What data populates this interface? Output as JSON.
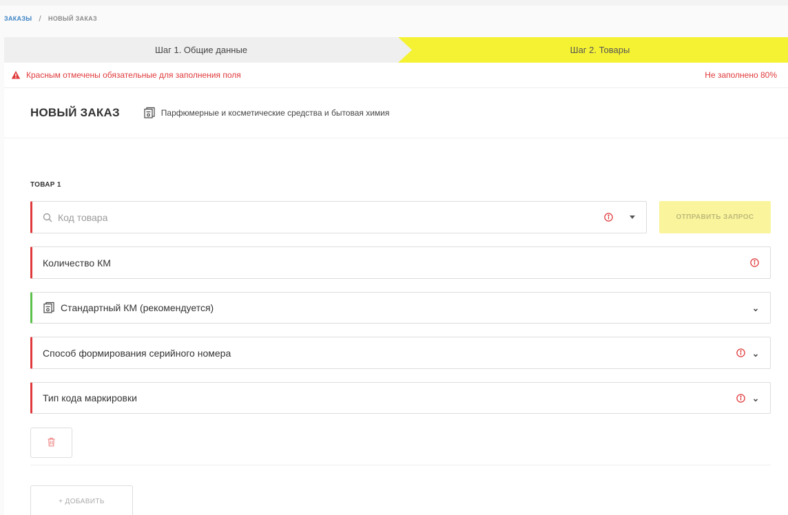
{
  "breadcrumb": {
    "root": "ЗАКАЗЫ",
    "separator": "/",
    "current": "НОВЫЙ ЗАКАЗ"
  },
  "steps": [
    {
      "label": "Шаг 1. Общие данные",
      "active": false
    },
    {
      "label": "Шаг 2. Товары",
      "active": true
    }
  ],
  "notice": {
    "message": "Красным отмечены обязательные для заполнения поля",
    "progress": "Не заполнено 80%"
  },
  "order": {
    "title": "НОВЫЙ ЗАКАЗ",
    "category": "Парфюмерные и косметические средства и бытовая химия"
  },
  "item": {
    "label": "ТОВАР 1",
    "code_placeholder": "Код товара",
    "send_label": "ОТПРАВИТЬ ЗАПРОС",
    "quantity_label": "Количество КМ",
    "km_type_label": "Стандартный КМ (рекомендуется)",
    "serial_method_label": "Способ формирования серийного номера",
    "code_type_label": "Тип кода маркировки"
  },
  "actions": {
    "add_label": "+ ДОБАВИТЬ"
  },
  "icons": {
    "warning": "warning-triangle-icon",
    "category": "km-box-icon",
    "search": "search-icon",
    "info": "info-circle-icon",
    "dropdown": "caret-down-icon",
    "chevron": "chevron-down-icon",
    "delete": "trash-icon"
  },
  "colors": {
    "accent_yellow": "#f5f233",
    "required_red": "#e0393b",
    "valid_green": "#5cc14a",
    "link_blue": "#3b82c4",
    "disabled_button": "#faf59c"
  }
}
